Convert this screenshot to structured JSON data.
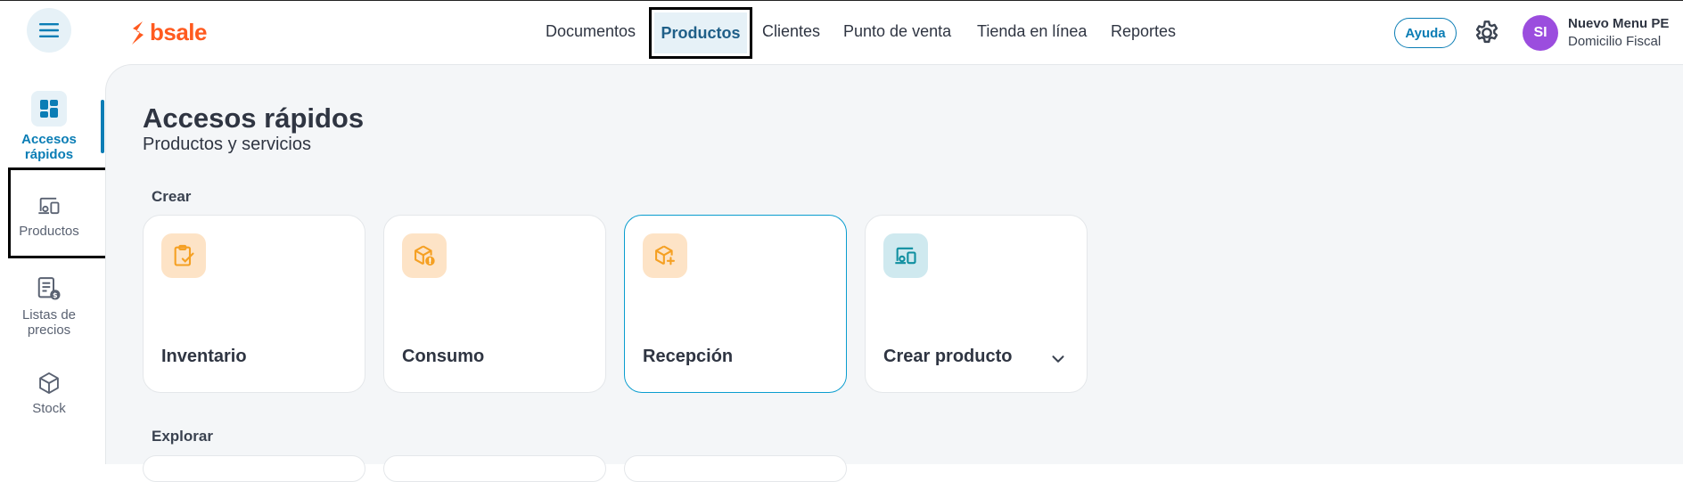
{
  "brand": {
    "name": "bsale",
    "color": "#ff5a1f"
  },
  "nav": {
    "items": [
      "Documentos",
      "Productos",
      "Clientes",
      "Punto de venta",
      "Tienda en línea",
      "Reportes"
    ],
    "active": "Productos"
  },
  "header": {
    "help_label": "Ayuda",
    "user_initials": "SI",
    "user_name": "Nuevo Menu PE",
    "user_location": "Domicilio Fiscal"
  },
  "sidebar": {
    "items": [
      {
        "label": "Accesos rápidos",
        "icon": "dashboard-icon",
        "active": true
      },
      {
        "label": "Productos",
        "icon": "devices-icon",
        "active": false
      },
      {
        "label": "Listas de precios",
        "icon": "price-list-icon",
        "active": false
      },
      {
        "label": "Stock",
        "icon": "cube-icon",
        "active": false
      }
    ]
  },
  "main": {
    "title": "Accesos rápidos",
    "subtitle": "Productos y servicios",
    "sections": {
      "create_label": "Crear",
      "explore_label": "Explorar"
    },
    "cards": [
      {
        "label": "Inventario",
        "icon": "clipboard-check-icon"
      },
      {
        "label": "Consumo",
        "icon": "box-alert-icon"
      },
      {
        "label": "Recepción",
        "icon": "box-plus-icon"
      },
      {
        "label": "Crear producto",
        "icon": "devices-icon"
      }
    ]
  },
  "colors": {
    "accent": "#0a7db5",
    "card_icon_orange_bg": "#fde3c6",
    "card_icon_orange": "#f5a023",
    "card_icon_teal_bg": "#cfe9ef",
    "card_icon_teal": "#0f8fa0",
    "avatar": "#9b4dde"
  }
}
